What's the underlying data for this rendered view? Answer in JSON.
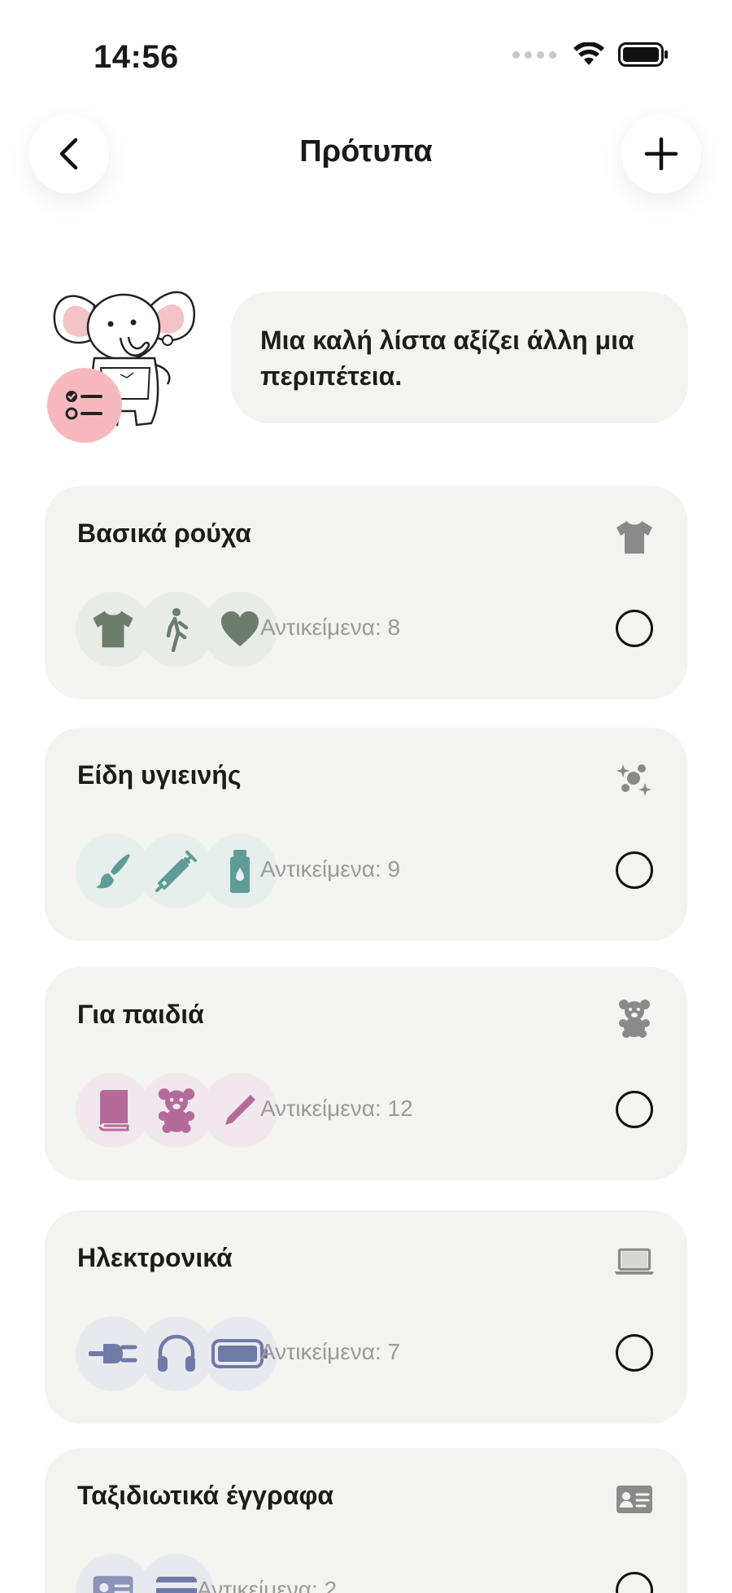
{
  "status": {
    "time": "14:56"
  },
  "header": {
    "title": "Πρότυπα"
  },
  "hero": {
    "message": "Μια καλή λίστα αξίζει άλλη μια περιπέτεια."
  },
  "templates": [
    {
      "title": "Βασικά ρούχα",
      "count_label": "Αντικείμενα: 8",
      "accent": "#6b7d6b",
      "bubble_bg": "#e9ebe7",
      "category_icon": "tshirt-icon",
      "items": [
        "tshirt-icon",
        "walking-icon",
        "heart-icon"
      ]
    },
    {
      "title": "Είδη υγιεινής",
      "count_label": "Αντικείμενα: 9",
      "accent": "#5f9c98",
      "bubble_bg": "#e7efec",
      "category_icon": "sparkles-icon",
      "items": [
        "brush-icon",
        "syringe-icon",
        "bottle-icon"
      ]
    },
    {
      "title": "Για παιδιά",
      "count_label": "Αντικείμενα: 12",
      "accent": "#b46b9a",
      "bubble_bg": "#f0e8ec",
      "category_icon": "teddy-bear-icon",
      "items": [
        "book-icon",
        "teddy-bear-icon",
        "pencil-icon"
      ]
    },
    {
      "title": "Ηλεκτρονικά",
      "count_label": "Αντικείμενα: 7",
      "accent": "#6f7aa6",
      "bubble_bg": "#e8e9ef",
      "category_icon": "laptop-icon",
      "items": [
        "plug-icon",
        "headphones-icon",
        "battery-icon"
      ]
    },
    {
      "title": "Ταξιδιωτικά έγγραφα",
      "count_label": "Αντικείμενα: 2",
      "accent": "#6f7aa6",
      "bubble_bg": "#e8e9ef",
      "category_icon": "id-card-icon",
      "items": [
        "id-card-icon",
        "credit-card-icon"
      ]
    }
  ]
}
